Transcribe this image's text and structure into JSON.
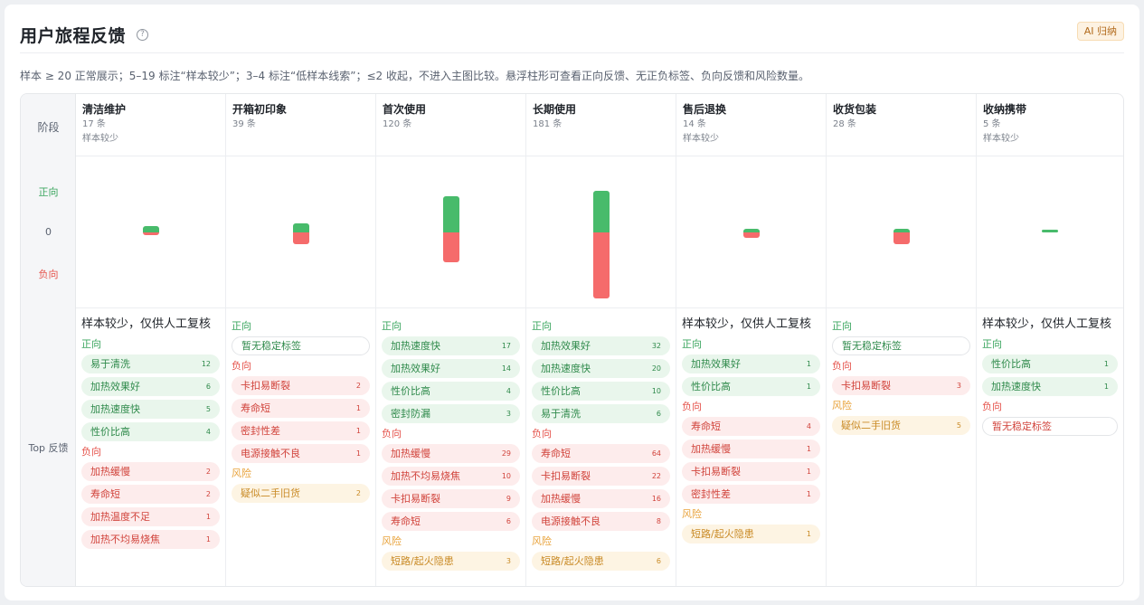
{
  "header": {
    "title": "用户旅程反馈",
    "help_icon": "?",
    "ai_badge": "AI 归纳"
  },
  "description": "样本 ≥ 20 正常展示；5–19 标注“样本较少”；3–4 标注“低样本线索”；≤2 收起，不进入主图比较。悬浮柱形可查看正向反馈、无正负标签、负向反馈和风险数量。",
  "row_labels": {
    "stage": "阶段",
    "positive": "正向",
    "zero": "0",
    "negative": "负向",
    "top_feedback": "Top 反馈"
  },
  "colors": {
    "positive": "#48bb6b",
    "negative": "#f56b6b",
    "risk": "#e8a23a"
  },
  "stages": [
    {
      "name": "清洁维护",
      "count": "17 条",
      "note": "样本较少",
      "bar_pos": 0.12,
      "bar_neg": 0.05,
      "warning": "样本较少，仅供人工复核",
      "groups": [
        {
          "kind": "pos",
          "label": "正向",
          "tags": [
            {
              "label": "易于清洗",
              "count": "12"
            },
            {
              "label": "加热效果好",
              "count": "6"
            },
            {
              "label": "加热速度快",
              "count": "5"
            },
            {
              "label": "性价比高",
              "count": "4"
            }
          ]
        },
        {
          "kind": "neg",
          "label": "负向",
          "tags": [
            {
              "label": "加热缓慢",
              "count": "2"
            },
            {
              "label": "寿命短",
              "count": "2"
            },
            {
              "label": "加热温度不足",
              "count": "1"
            },
            {
              "label": "加热不均易烧焦",
              "count": "1"
            }
          ]
        }
      ]
    },
    {
      "name": "开箱初印象",
      "count": "39 条",
      "note": "",
      "bar_pos": 0.16,
      "bar_neg": 0.22,
      "warning": "",
      "groups": [
        {
          "kind": "pos",
          "label": "正向",
          "tags": [
            {
              "label": "暂无稳定标签",
              "count": "",
              "empty": true
            }
          ]
        },
        {
          "kind": "neg",
          "label": "负向",
          "tags": [
            {
              "label": "卡扣易断裂",
              "count": "2"
            },
            {
              "label": "寿命短",
              "count": "1"
            },
            {
              "label": "密封性差",
              "count": "1"
            },
            {
              "label": "电源接触不良",
              "count": "1"
            }
          ]
        },
        {
          "kind": "risk",
          "label": "风险",
          "tags": [
            {
              "label": "疑似二手旧货",
              "count": "2"
            }
          ]
        }
      ]
    },
    {
      "name": "首次使用",
      "count": "120 条",
      "note": "",
      "bar_pos": 0.66,
      "bar_neg": 0.55,
      "warning": "",
      "groups": [
        {
          "kind": "pos",
          "label": "正向",
          "tags": [
            {
              "label": "加热速度快",
              "count": "17"
            },
            {
              "label": "加热效果好",
              "count": "14"
            },
            {
              "label": "性价比高",
              "count": "4"
            },
            {
              "label": "密封防漏",
              "count": "3"
            }
          ]
        },
        {
          "kind": "neg",
          "label": "负向",
          "tags": [
            {
              "label": "加热缓慢",
              "count": "29"
            },
            {
              "label": "加热不均易烧焦",
              "count": "10"
            },
            {
              "label": "卡扣易断裂",
              "count": "9"
            },
            {
              "label": "寿命短",
              "count": "6"
            }
          ]
        },
        {
          "kind": "risk",
          "label": "风险",
          "tags": [
            {
              "label": "短路/起火隐患",
              "count": "3"
            }
          ]
        }
      ]
    },
    {
      "name": "长期使用",
      "count": "181 条",
      "note": "",
      "bar_pos": 0.77,
      "bar_neg": 1.22,
      "warning": "",
      "groups": [
        {
          "kind": "pos",
          "label": "正向",
          "tags": [
            {
              "label": "加热效果好",
              "count": "32"
            },
            {
              "label": "加热速度快",
              "count": "20"
            },
            {
              "label": "性价比高",
              "count": "10"
            },
            {
              "label": "易于清洗",
              "count": "6"
            }
          ]
        },
        {
          "kind": "neg",
          "label": "负向",
          "tags": [
            {
              "label": "寿命短",
              "count": "64"
            },
            {
              "label": "卡扣易断裂",
              "count": "22"
            },
            {
              "label": "加热缓慢",
              "count": "16"
            },
            {
              "label": "电源接触不良",
              "count": "8"
            }
          ]
        },
        {
          "kind": "risk",
          "label": "风险",
          "tags": [
            {
              "label": "短路/起火隐患",
              "count": "6"
            }
          ]
        }
      ]
    },
    {
      "name": "售后退换",
      "count": "14 条",
      "note": "样本较少",
      "bar_pos": 0.06,
      "bar_neg": 0.1,
      "warning": "样本较少，仅供人工复核",
      "groups": [
        {
          "kind": "pos",
          "label": "正向",
          "tags": [
            {
              "label": "加热效果好",
              "count": "1"
            },
            {
              "label": "性价比高",
              "count": "1"
            }
          ]
        },
        {
          "kind": "neg",
          "label": "负向",
          "tags": [
            {
              "label": "寿命短",
              "count": "4"
            },
            {
              "label": "加热缓慢",
              "count": "1"
            },
            {
              "label": "卡扣易断裂",
              "count": "1"
            },
            {
              "label": "密封性差",
              "count": "1"
            }
          ]
        },
        {
          "kind": "risk",
          "label": "风险",
          "tags": [
            {
              "label": "短路/起火隐患",
              "count": "1"
            }
          ]
        }
      ]
    },
    {
      "name": "收货包装",
      "count": "28 条",
      "note": "",
      "bar_pos": 0.06,
      "bar_neg": 0.22,
      "warning": "",
      "groups": [
        {
          "kind": "pos",
          "label": "正向",
          "tags": [
            {
              "label": "暂无稳定标签",
              "count": "",
              "empty": true
            }
          ]
        },
        {
          "kind": "neg",
          "label": "负向",
          "tags": [
            {
              "label": "卡扣易断裂",
              "count": "3"
            }
          ]
        },
        {
          "kind": "risk",
          "label": "风险",
          "tags": [
            {
              "label": "疑似二手旧货",
              "count": "5"
            }
          ]
        }
      ]
    },
    {
      "name": "收纳携带",
      "count": "5 条",
      "note": "样本较少",
      "bar_pos": 0.05,
      "bar_neg": 0,
      "warning": "样本较少，仅供人工复核",
      "groups": [
        {
          "kind": "pos",
          "label": "正向",
          "tags": [
            {
              "label": "性价比高",
              "count": "1"
            },
            {
              "label": "加热速度快",
              "count": "1"
            }
          ]
        },
        {
          "kind": "neg",
          "label": "负向",
          "tags": [
            {
              "label": "暂无稳定标签",
              "count": "",
              "empty": true
            }
          ]
        }
      ]
    }
  ]
}
